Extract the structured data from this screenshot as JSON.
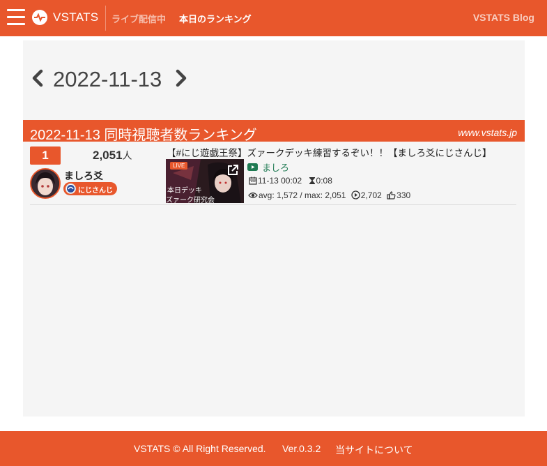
{
  "header": {
    "brand": "VSTATS",
    "nav_live": "ライブ配信中",
    "nav_ranking": "本日のランキング",
    "nav_blog": "VSTATS Blog"
  },
  "date_nav": {
    "date": "2022-11-13"
  },
  "section": {
    "title": "2022-11-13 同時視聴者数ランキング",
    "site": "www.vstats.jp"
  },
  "ranking": [
    {
      "rank": "1",
      "viewers": "2,051",
      "viewers_unit": "人",
      "channel_name": "ましろ爻",
      "org": "にじさんじ",
      "video_title": "【#にじ遊戯王祭】ズァークデッキ練習するぞい！！【ましろ爻にじさんじ】",
      "thumb_live": "LIVE",
      "thumb_text1": "本日デッキ",
      "thumb_text2": "ズァーク研究会",
      "yt_channel": "ましろ",
      "start": "11-13 00:02",
      "duration": "0:08",
      "avg": "avg: 1,572 / max: 2,051",
      "views": "2,702",
      "likes": "330"
    }
  ],
  "footer": {
    "copyright": "VSTATS © All Right Reserved.",
    "version": "Ver.0.3.2",
    "about": "当サイトについて"
  },
  "colors": {
    "brand": "#e8572c",
    "youtube": "#1e7a52",
    "panel_bg": "#f5f5f5"
  }
}
